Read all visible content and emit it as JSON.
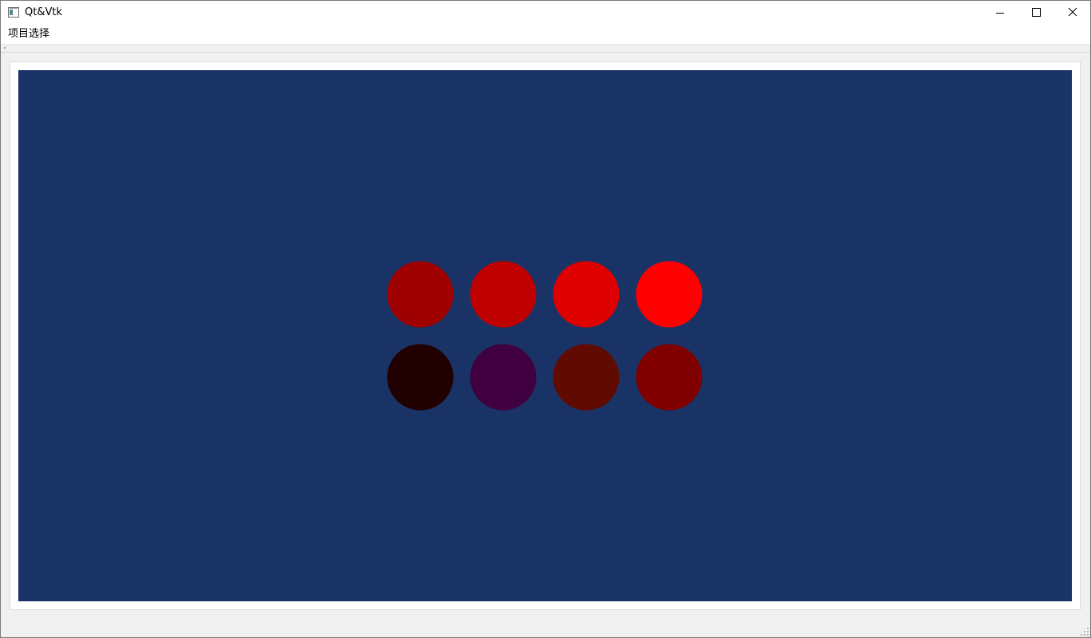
{
  "window": {
    "title": "Qt&Vtk"
  },
  "menubar": {
    "items": [
      {
        "label": "项目选择"
      }
    ]
  },
  "viewport": {
    "background_color": "#1a3366",
    "spheres": [
      {
        "row": 0,
        "col": 0,
        "color": "#9f0000"
      },
      {
        "row": 0,
        "col": 1,
        "color": "#bf0000"
      },
      {
        "row": 0,
        "col": 2,
        "color": "#df0000"
      },
      {
        "row": 0,
        "col": 3,
        "color": "#ff0000"
      },
      {
        "row": 1,
        "col": 0,
        "color": "#200000"
      },
      {
        "row": 1,
        "col": 1,
        "color": "#40003f"
      },
      {
        "row": 1,
        "col": 2,
        "color": "#600a00"
      },
      {
        "row": 1,
        "col": 3,
        "color": "#800000"
      }
    ]
  }
}
